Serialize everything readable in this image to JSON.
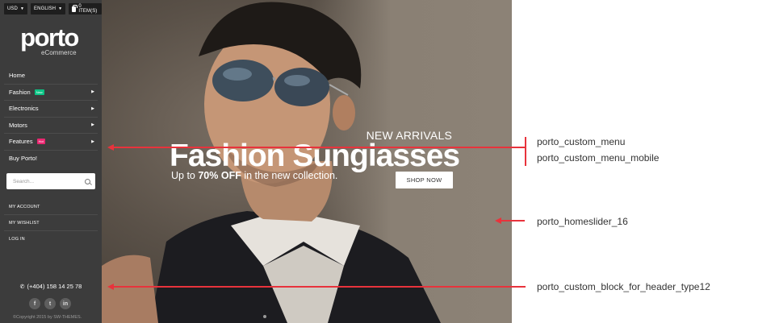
{
  "topbar": {
    "currency": "USD",
    "language": "ENGLISH",
    "cart": "0 ITEM(S)"
  },
  "logo": {
    "word": "porto",
    "sub": "eCommerce"
  },
  "menu": {
    "items": [
      {
        "label": "Home"
      },
      {
        "label": "Fashion",
        "badge": "New"
      },
      {
        "label": "Electronics"
      },
      {
        "label": "Motors"
      },
      {
        "label": "Features",
        "badge": "Hot"
      },
      {
        "label": "Buy Porto!"
      }
    ]
  },
  "search": {
    "placeholder": "Search..."
  },
  "account": {
    "items": [
      "MY ACCOUNT",
      "MY WISHLIST",
      "LOG IN"
    ]
  },
  "contact": {
    "phone": "(+404) 158 14 25 78"
  },
  "social": [
    "f",
    "t",
    "in"
  ],
  "copyright": "©Copyright 2015 by SW-THEMES.",
  "hero": {
    "kicker": "NEW ARRIVALS",
    "title": "Fashion Sungiasses",
    "sub_prefix": "Up to ",
    "sub_bold": "70% OFF",
    "sub_suffix": " in the new collection.",
    "button": "SHOP NOW"
  },
  "annotations": {
    "menu": "porto_custom_menu",
    "menu_mobile": "porto_custom_menu_mobile",
    "slider": "porto_homeslider_16",
    "block": "porto_custom_block_for_header_type12"
  },
  "colors": {
    "sidebar_bg": "#3c3c3c",
    "badge_new": "#0cc485",
    "badge_hot": "#eb2771",
    "annotation": "#e8333c"
  }
}
